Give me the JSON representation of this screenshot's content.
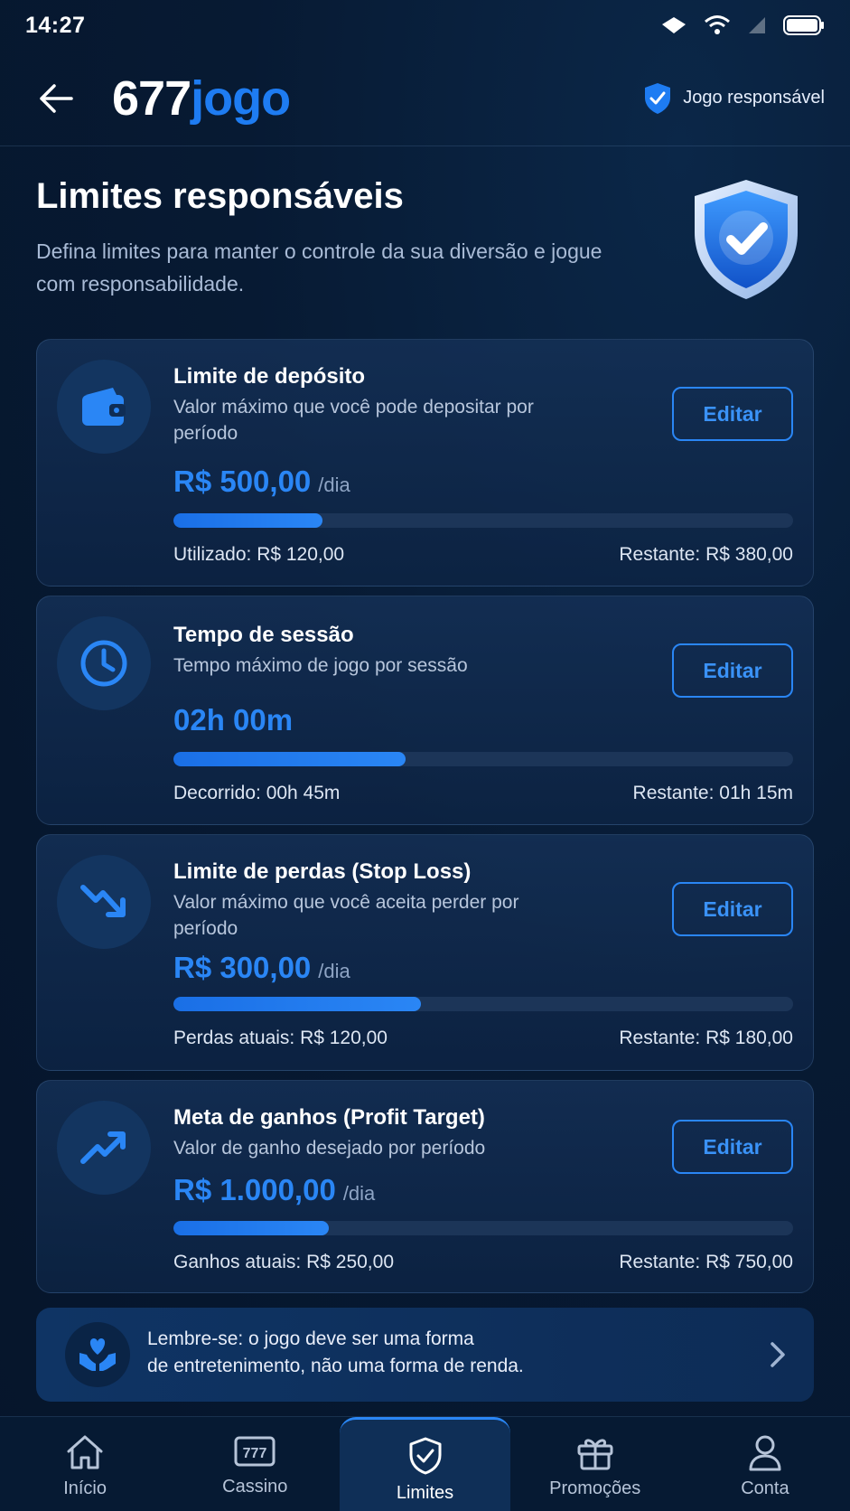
{
  "status_bar": {
    "time": "14:27"
  },
  "header": {
    "logo_number": "677",
    "logo_word": "jogo",
    "responsible_label": "Jogo responsável"
  },
  "hero": {
    "title": "Limites responsáveis",
    "subtitle": "Defina limites para manter o controle da sua diversão e jogue com responsabilidade."
  },
  "cards": [
    {
      "icon": "wallet-icon",
      "title": "Limite de depósito",
      "description": "Valor máximo que você pode depositar por período",
      "value": "R$ 500,00",
      "unit": "/dia",
      "edit_label": "Editar",
      "progress_fraction": 0.24,
      "used_label": "Utilizado: R$ 120,00",
      "remaining_label": "Restante: R$ 380,00"
    },
    {
      "icon": "clock-icon",
      "title": "Tempo de sessão",
      "description": "Tempo máximo de jogo por sessão",
      "value": "02h 00m",
      "unit": "",
      "edit_label": "Editar",
      "progress_fraction": 0.375,
      "used_label": "Decorrido: 00h 45m",
      "remaining_label": "Restante: 01h 15m"
    },
    {
      "icon": "trend-down-icon",
      "title": "Limite de perdas (Stop Loss)",
      "description": "Valor máximo que você aceita perder por período",
      "value": "R$ 300,00",
      "unit": "/dia",
      "edit_label": "Editar",
      "progress_fraction": 0.4,
      "used_label": "Perdas atuais: R$ 120,00",
      "remaining_label": "Restante: R$ 180,00"
    },
    {
      "icon": "trend-up-icon",
      "title": "Meta de ganhos (Profit Target)",
      "description": "Valor de ganho desejado por período",
      "value": "R$ 1.000,00",
      "unit": "/dia",
      "edit_label": "Editar",
      "progress_fraction": 0.25,
      "used_label": "Ganhos atuais: R$ 250,00",
      "remaining_label": "Restante: R$ 750,00"
    }
  ],
  "reminder": {
    "icon": "heart-hands-icon",
    "text_line1": "Lembre-se: o jogo deve ser uma forma",
    "text_line2": "de entretenimento, não uma forma de renda."
  },
  "bottom_nav": [
    {
      "label": "Início",
      "icon": "home-icon",
      "active": false
    },
    {
      "label": "Cassino",
      "icon": "slot-machine-icon",
      "active": false
    },
    {
      "label": "Limites",
      "icon": "shield-check-icon",
      "active": true
    },
    {
      "label": "Promoções",
      "icon": "gift-icon",
      "active": false
    },
    {
      "label": "Conta",
      "icon": "user-icon",
      "active": false
    }
  ],
  "colors": {
    "accent": "#2a86f5",
    "background": "#071a33",
    "card": "#12305a"
  }
}
